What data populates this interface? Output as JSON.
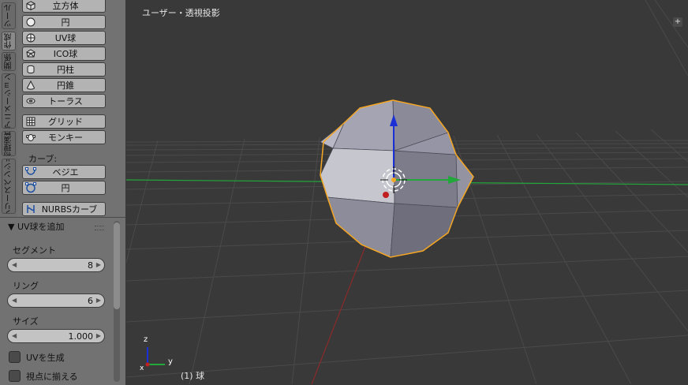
{
  "tabs": [
    {
      "label": "ツール"
    },
    {
      "label": "作成"
    },
    {
      "label": "関係"
    },
    {
      "label": "アニメーション"
    },
    {
      "label": "物理演算"
    },
    {
      "label": "グリースペンシル"
    }
  ],
  "mesh_buttons": [
    {
      "label": "立方体",
      "icon": "cube-icon"
    },
    {
      "label": "円",
      "icon": "circle-icon"
    },
    {
      "label": "UV球",
      "icon": "uv-sphere-icon"
    },
    {
      "label": "ICO球",
      "icon": "ico-sphere-icon"
    },
    {
      "label": "円柱",
      "icon": "cylinder-icon"
    },
    {
      "label": "円錐",
      "icon": "cone-icon"
    },
    {
      "label": "トーラス",
      "icon": "torus-icon"
    }
  ],
  "extra_buttons": [
    {
      "label": "グリッド",
      "icon": "grid-icon"
    },
    {
      "label": "モンキー",
      "icon": "monkey-icon"
    }
  ],
  "curve_section": {
    "label": "カーブ:"
  },
  "curve_buttons": [
    {
      "label": "ベジエ",
      "icon": "bezier-icon"
    },
    {
      "label": "円",
      "icon": "curve-circle-icon"
    },
    {
      "label": "NURBSカーブ",
      "icon": "nurbs-icon"
    }
  ],
  "operator": {
    "title": "▼ UV球を追加",
    "segments_label": "セグメント",
    "segments_value": "8",
    "rings_label": "リング",
    "rings_value": "6",
    "size_label": "サイズ",
    "size_value": "1.000",
    "generate_uv_label": "UVを生成",
    "align_view_label": "視点に揃える"
  },
  "viewport": {
    "title": "ユーザー・透視投影",
    "status": "(1) 球",
    "axis_x_label": "x",
    "axis_y_label": "y",
    "corner_button": "+"
  },
  "colors": {
    "selection_outline": "#f5a623",
    "x_axis": "#8b2a2a",
    "y_axis": "#22a83a",
    "z_axis": "#1a2fd6",
    "mesh_face": "#8d8d9c"
  }
}
